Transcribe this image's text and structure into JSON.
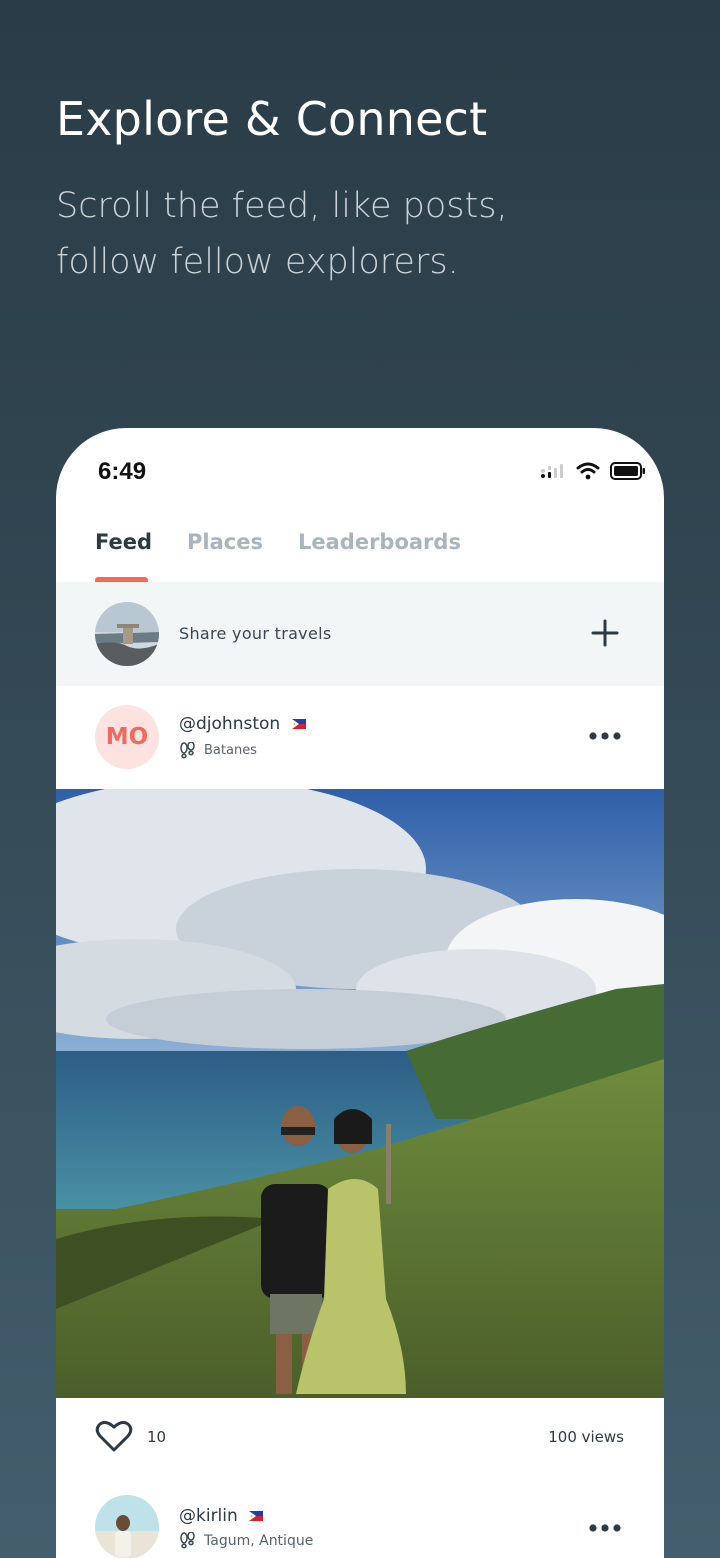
{
  "promo": {
    "headline": "Explore & Connect",
    "subline": "Scroll the feed, like posts, follow fellow explorers."
  },
  "status_bar": {
    "time": "6:49"
  },
  "tabs": [
    {
      "label": "Feed",
      "active": true
    },
    {
      "label": "Places",
      "active": false
    },
    {
      "label": "Leaderboards",
      "active": false
    }
  ],
  "composer": {
    "prompt": "Share your travels"
  },
  "posts": [
    {
      "initials": "MO",
      "username": "@djohnston",
      "location": "Batanes",
      "likes": "10",
      "views": "100 views"
    },
    {
      "username": "@kirlin",
      "location": "Tagum, Antique"
    }
  ],
  "colors": {
    "accent": "#ef6b5f",
    "text_dark": "#2b3a43",
    "tab_inactive": "#a8b5bd"
  }
}
